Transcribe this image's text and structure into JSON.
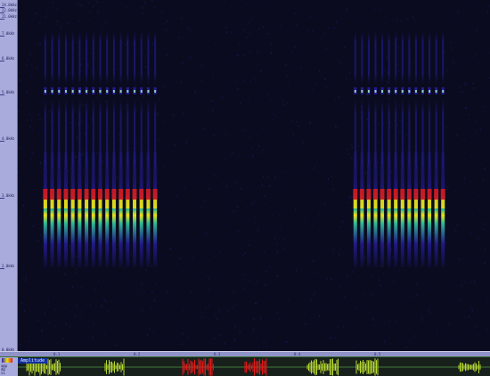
{
  "frequency_axis": {
    "labels": [
      "24.0kHz",
      "22.0kHz",
      "21.0kHz",
      "7.0kHz",
      "6.0kHz",
      "5.0kHz",
      "4.0kHz",
      "3.0kHz",
      "2.0kHz",
      "0.0kHz"
    ]
  },
  "time_axis": {
    "labels": [
      "0.1",
      "0.2",
      "0.3",
      "0.4",
      "0.5"
    ]
  },
  "waveform": {
    "title": "Amplitude",
    "side_labels": [
      "amp",
      "dB",
      "x1"
    ]
  },
  "colors": {
    "background": "#0a0b1f",
    "ruler": "#a9abdd",
    "low": "#2a1fb0",
    "mid": "#34d0a0",
    "high": "#f0e010",
    "peak": "#e21a1a",
    "wave": "#b8d830",
    "wave_bg": "#18201c"
  }
}
